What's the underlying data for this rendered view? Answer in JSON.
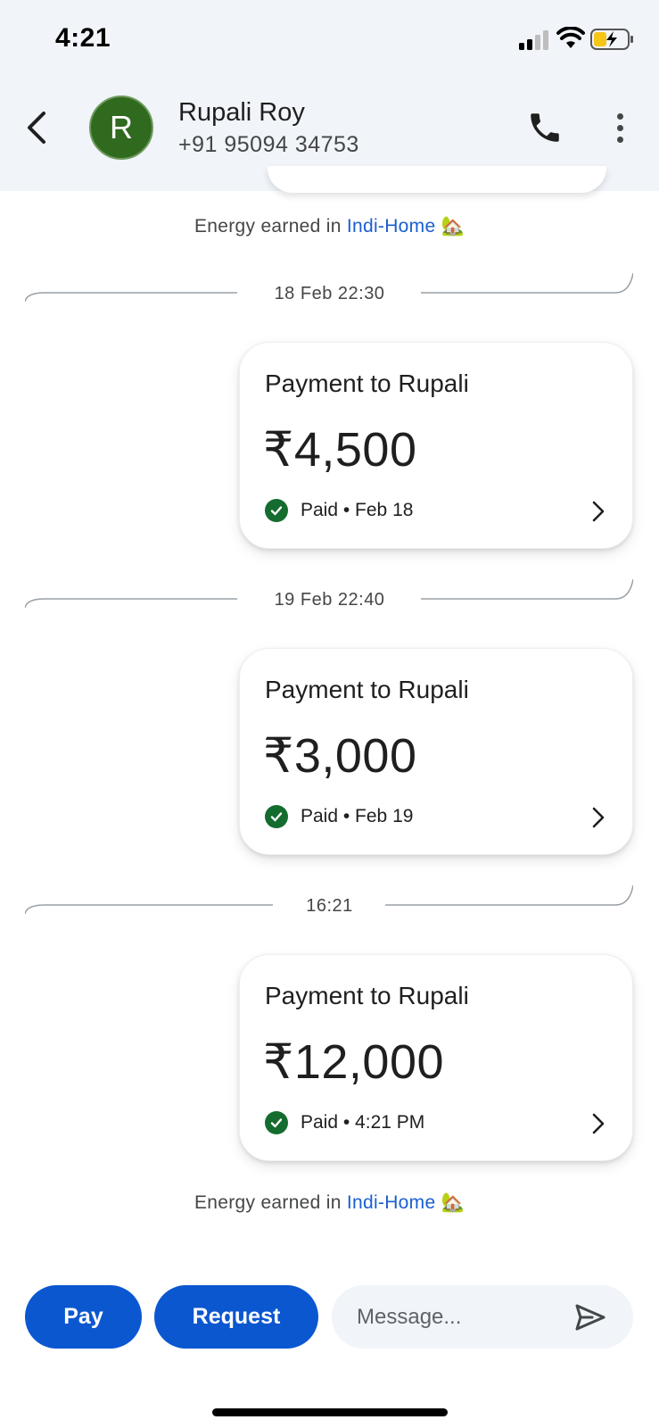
{
  "status_bar": {
    "time": "4:21"
  },
  "header": {
    "avatar_initial": "R",
    "name": "Rupali Roy",
    "phone": "+91 95094 34753"
  },
  "energy_note": {
    "prefix": "Energy earned in",
    "link": "Indi-Home",
    "emoji": "🏡"
  },
  "messages": [
    {
      "timestamp": "18 Feb 22:30",
      "title": "Payment to Rupali",
      "amount": "₹4,500",
      "status": "Paid • Feb 18"
    },
    {
      "timestamp": "19 Feb 22:40",
      "title": "Payment to Rupali",
      "amount": "₹3,000",
      "status": "Paid • Feb 19"
    },
    {
      "timestamp": "16:21",
      "title": "Payment to Rupali",
      "amount": "₹12,000",
      "status": "Paid • 4:21 PM"
    }
  ],
  "composer": {
    "pay_label": "Pay",
    "request_label": "Request",
    "message_placeholder": "Message..."
  },
  "colors": {
    "accent": "#0b57d0",
    "paid_green": "#146c2e",
    "avatar_green": "#2f6a1e",
    "header_bg": "#f1f4f9",
    "link": "#1a5fd0"
  }
}
